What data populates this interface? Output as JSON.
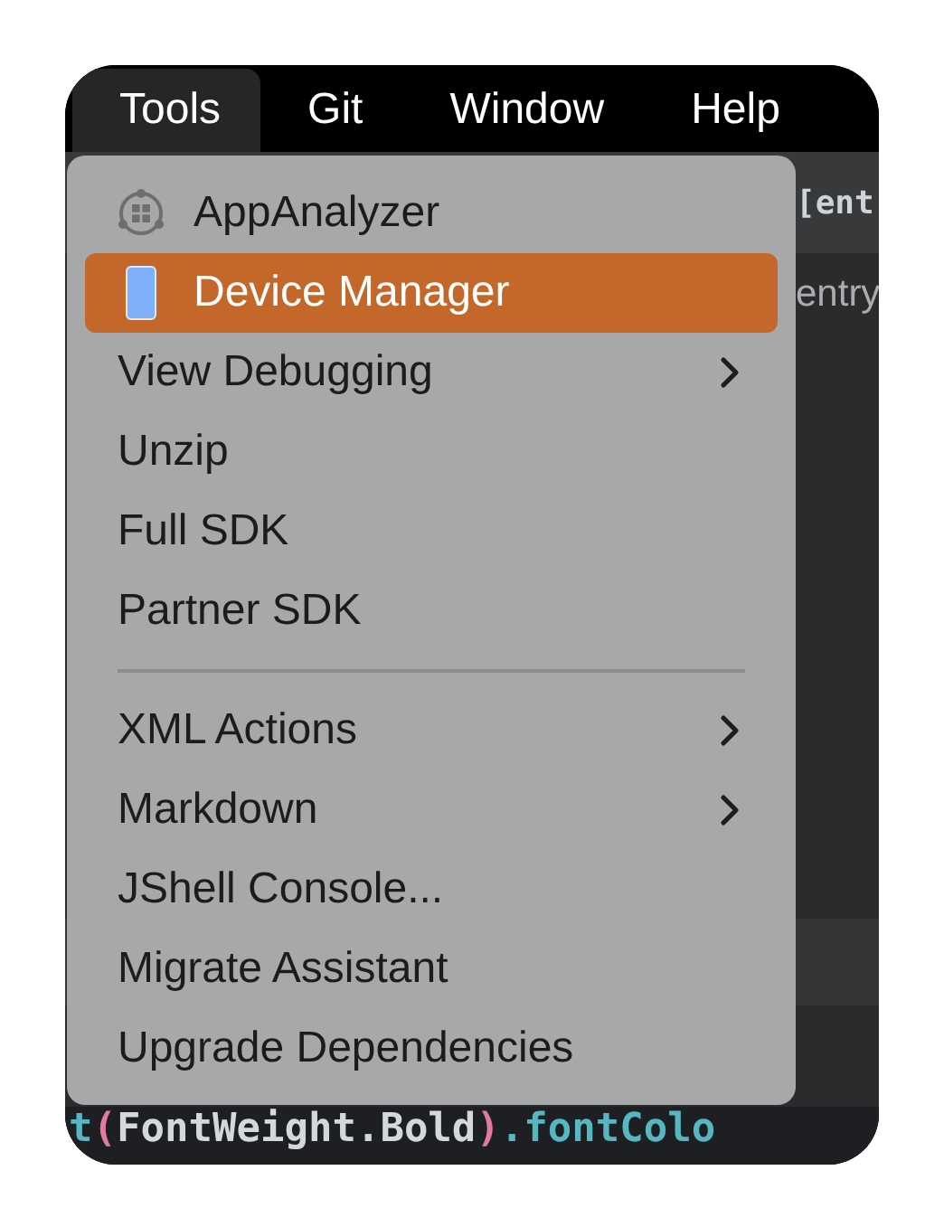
{
  "menubar": [
    {
      "label": "Tools",
      "selected": true
    },
    {
      "label": "Git",
      "selected": false
    },
    {
      "label": "Window",
      "selected": false
    },
    {
      "label": "Help",
      "selected": false
    }
  ],
  "editor": {
    "lines": [
      {
        "kind": "header",
        "tokens": [
          {
            "text": "[ent",
            "color": "#cfd2d6"
          }
        ]
      },
      {
        "kind": "row",
        "tokens": [
          {
            "text": "entry",
            "color": "#a9acb0"
          }
        ]
      },
      {
        "kind": "blank"
      },
      {
        "kind": "band"
      },
      {
        "kind": "blank2"
      },
      {
        "kind": "code",
        "tokens": [
          {
            "text": "t",
            "color": "#56b6c2"
          },
          {
            "text": "(",
            "color": "#e07aa0"
          },
          {
            "text": "FontWeight.Bold",
            "color": "#d4d7dc"
          },
          {
            "text": ")",
            "color": "#e07aa0"
          },
          {
            "text": ".fontColo",
            "color": "#56b6c2"
          }
        ]
      }
    ]
  },
  "menu": {
    "items": [
      {
        "kind": "icon",
        "label": "AppAnalyzer",
        "selected": false
      },
      {
        "kind": "icon",
        "label": "Device Manager",
        "selected": true
      },
      {
        "kind": "submenu",
        "label": "View Debugging",
        "selected": false
      },
      {
        "kind": "command",
        "label": "Unzip",
        "selected": false
      },
      {
        "kind": "command",
        "label": "Full SDK",
        "selected": false
      },
      {
        "kind": "command",
        "label": "Partner SDK",
        "selected": false
      },
      {
        "kind": "separator"
      },
      {
        "kind": "submenu",
        "label": "XML Actions",
        "selected": false
      },
      {
        "kind": "submenu",
        "label": "Markdown",
        "selected": false
      },
      {
        "kind": "command",
        "label": "JShell Console...",
        "selected": false
      },
      {
        "kind": "command",
        "label": "Migrate Assistant",
        "selected": false
      },
      {
        "kind": "command",
        "label": "Upgrade Dependencies",
        "selected": false
      }
    ]
  }
}
